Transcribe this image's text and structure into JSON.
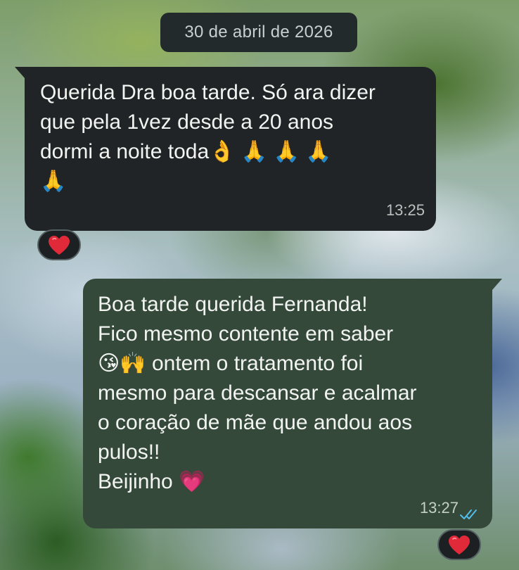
{
  "chat": {
    "date_separator": "30 de abril de 2026",
    "messages": [
      {
        "direction": "incoming",
        "lines": [
          "Querida Dra boa tarde. Só ara dizer",
          "que pela 1vez desde a 20 anos",
          "dormi a noite toda👌 🙏 🙏 🙏",
          "🙏"
        ],
        "time": "13:25",
        "reaction": "❤️"
      },
      {
        "direction": "outgoing",
        "lines": [
          "Boa tarde querida Fernanda!",
          "Fico mesmo contente em saber",
          "😘🙌 ontem o tratamento foi",
          "mesmo para descansar e acalmar",
          "o coração de mãe que andou aos",
          "pulos!!",
          "Beijinho 💗"
        ],
        "time": "13:27",
        "status": "read",
        "reaction": "❤️"
      }
    ]
  },
  "colors": {
    "incoming_bubble": "#202426",
    "outgoing_bubble": "#34493a",
    "read_ticks": "#53bdeb",
    "reaction_heart": "#e02a3a"
  },
  "icons": {
    "read_status": "double-check-icon",
    "reaction": "heart-icon"
  }
}
